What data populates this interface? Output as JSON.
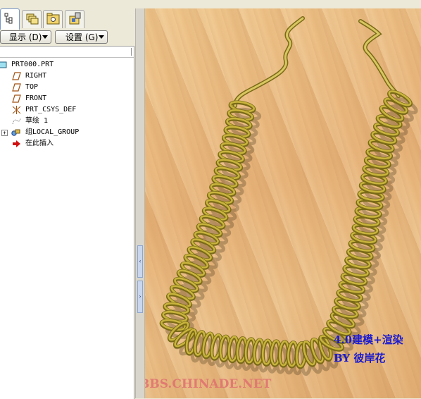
{
  "tabs": [
    {
      "id": "model-tree",
      "icon": "model-tree-icon"
    },
    {
      "id": "layers",
      "icon": "layers-icon"
    },
    {
      "id": "folder-browser",
      "icon": "folder-browser-icon"
    },
    {
      "id": "favorites",
      "icon": "favorites-icon"
    }
  ],
  "toolbar": {
    "display_label": "显示 (D)",
    "settings_label": "设置 (G)"
  },
  "tree": {
    "items": [
      {
        "label": "PRT000.PRT",
        "icon": "part-icon"
      },
      {
        "label": "RIGHT",
        "icon": "datum-plane-icon"
      },
      {
        "label": "TOP",
        "icon": "datum-plane-icon"
      },
      {
        "label": "FRONT",
        "icon": "datum-plane-icon"
      },
      {
        "label": "PRT_CSYS_DEF",
        "icon": "coordinate-system-icon"
      },
      {
        "label": "草绘 1",
        "icon": "sketch-icon"
      },
      {
        "label": "组LOCAL_GROUP",
        "icon": "group-icon"
      },
      {
        "label": "在此插入",
        "icon": "insert-here-arrow-icon"
      }
    ]
  },
  "viewport": {
    "caption_line1": "4.0建模+渲染",
    "caption_line2": "BY 彼岸花",
    "watermark": "BBS.CHINADE.NET",
    "coil_color": "#c8b43c",
    "coil_shadow_color": "#7a6a18",
    "caption_color": "#1a1ad0"
  }
}
